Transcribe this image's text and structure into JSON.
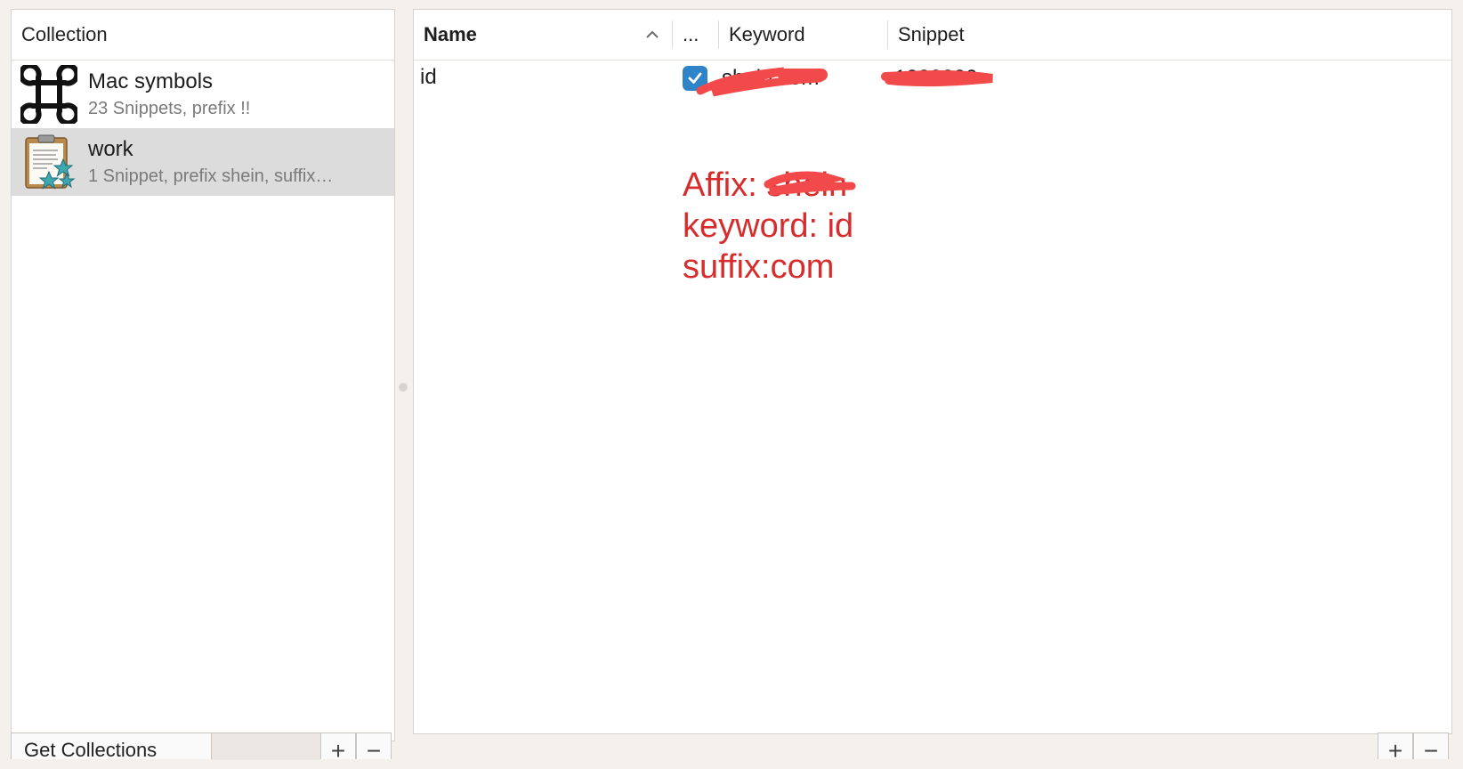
{
  "collections_panel": {
    "header": "Collection",
    "items": [
      {
        "name": "Mac symbols",
        "subtitle": "23 Snippets, prefix !!",
        "icon": "command-key-icon",
        "selected": false
      },
      {
        "name": "work",
        "subtitle": "1 Snippet, prefix shein, suffix…",
        "icon": "clipboard-stars-icon",
        "selected": true
      }
    ],
    "footer": {
      "get_collections_label": "Get Collections",
      "add_label": "+",
      "remove_label": "−"
    }
  },
  "snippets_table": {
    "columns": {
      "name": "Name",
      "enabled": "...",
      "keyword": "Keyword",
      "snippet": "Snippet"
    },
    "sort": {
      "column": "Name",
      "direction": "ascending"
    },
    "rows": [
      {
        "name": "id",
        "enabled": true,
        "keyword": "shein.com",
        "snippet": "1000000"
      }
    ],
    "footer": {
      "add_label": "+",
      "remove_label": "−"
    }
  },
  "annotation": {
    "line1": "Affix: shein",
    "line2": "keyword: id",
    "line3": "suffix:com",
    "color": "#d62c2c"
  },
  "colors": {
    "redaction": "#f24a4a",
    "checkbox": "#2f84c8",
    "selected_row": "#dcdcdc",
    "window_bg": "#f4f0ec"
  }
}
